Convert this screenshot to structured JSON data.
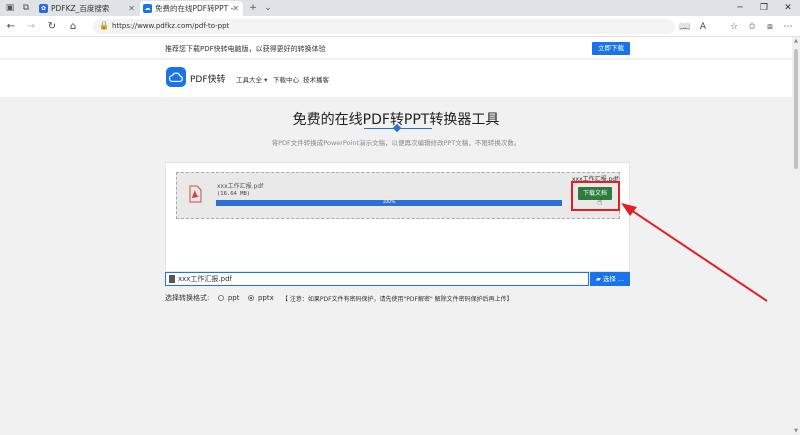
{
  "browser": {
    "tabs": [
      {
        "label": "PDFKZ_百度搜索",
        "active": false
      },
      {
        "label": "免费的在线PDF转PPT -",
        "active": true
      }
    ],
    "new_tab_symbol": "+",
    "url": "https://www.pdfkz.com/pdf-to-ppt"
  },
  "promo": {
    "text": "推荐您下载PDF快转电脑版，以获得更好的转换体验",
    "button": "立即下载"
  },
  "header": {
    "logo_text": "PDF快转",
    "nav": [
      "工具大全 ▾",
      "下载中心",
      "技术播客"
    ]
  },
  "main": {
    "title": "免费的在线PDF转PPT转换器工具",
    "subtitle": "将PDF文件转换成PowerPoint演示文稿，以便再次编辑修改PPT文稿，不限转换次数。"
  },
  "file": {
    "name": "xxx工作汇报.pdf",
    "size": "(16.64 MB)",
    "progress_label": "100%",
    "progress": 1.0,
    "name_right": "xxx工作汇报.pdf",
    "download_button": "下载文档"
  },
  "upload": {
    "value": "xxx工作汇报.pdf",
    "choose_button": "选择 ..."
  },
  "format": {
    "label": "选择转换格式:",
    "options": [
      {
        "label": "ppt",
        "selected": false
      },
      {
        "label": "pptx",
        "selected": true
      }
    ],
    "notice": "【 注意：如果PDF文件有密码保护，请先使用\"PDF解密\" 解除文件密码保护后再上传】"
  },
  "colors": {
    "accent": "#1a73e8",
    "download": "#2f7a3d",
    "highlight": "#e02020"
  }
}
